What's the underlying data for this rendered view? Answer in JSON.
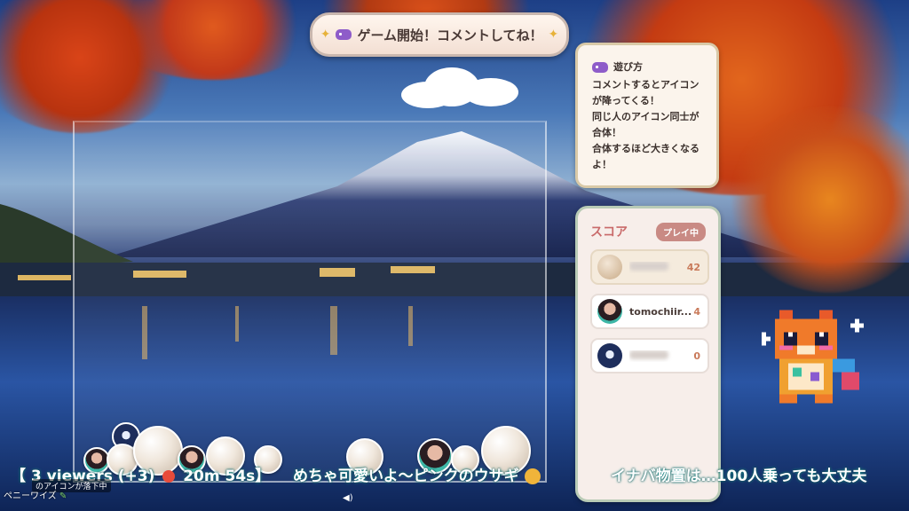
{
  "banner": {
    "text": "ゲーム開始！コメントしてね！"
  },
  "howto": {
    "title": "遊び方",
    "lines": [
      "コメントするとアイコン",
      "が降ってくる！",
      "同じ人のアイコン同士が",
      "合体！",
      "合体するほど大きくなる",
      "よ！"
    ]
  },
  "score": {
    "title": "スコア",
    "status": "プレイ中",
    "players": [
      {
        "name": "",
        "points": "42"
      },
      {
        "name": "tomochiir...",
        "points": "4"
      },
      {
        "name": "",
        "points": "0"
      }
    ]
  },
  "ticker": {
    "viewers": "【 3 viewers (+3)",
    "time": "20m 54s】",
    "comment1": "めちゃ可愛いよ～ピンクのウサギ",
    "comment2": "イナバ物置は…100人乗っても大丈夫"
  },
  "notice": "のアイコンが落下中",
  "sub_label": "ペニーワイズ",
  "colors": {
    "accent": "#c96a6a",
    "banner_text": "#4a3a36",
    "panel_bg": "#fbf4ec"
  }
}
